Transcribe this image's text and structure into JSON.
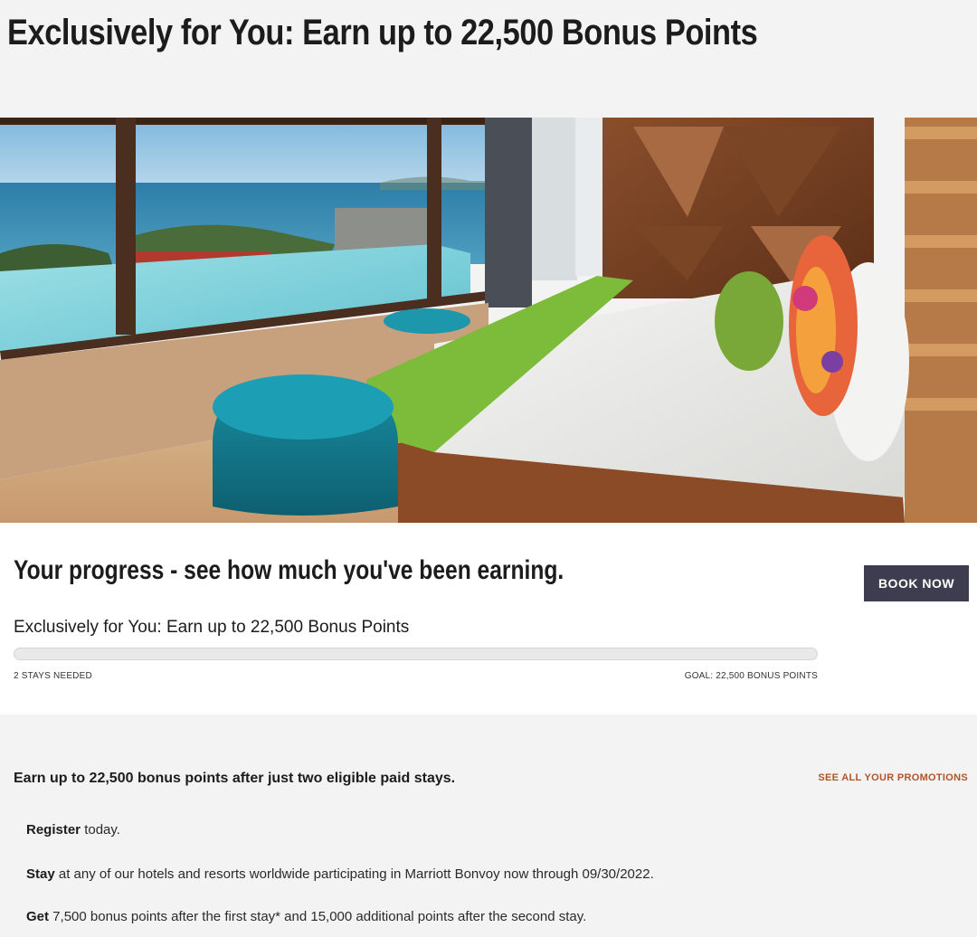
{
  "header": {
    "title": "Exclusively for You: Earn up to 22,500 Bonus Points"
  },
  "hero": {
    "image_description_icon": "hotel-room-ocean-view-image"
  },
  "progress": {
    "heading": "Your progress - see how much you've been earning.",
    "book_button_label": "BOOK NOW",
    "promo_title": "Exclusively for You: Earn up to 22,500 Bonus Points",
    "progress_fraction": 0,
    "stays_label": "2 STAYS NEEDED",
    "goal_label": "GOAL: 22,500 BONUS POINTS"
  },
  "details": {
    "heading": "Earn up to 22,500 bonus points after just two eligible paid stays.",
    "see_all_label": "SEE ALL YOUR PROMOTIONS",
    "steps": [
      {
        "bold": "Register",
        "text": " today."
      },
      {
        "bold": "Stay",
        "text": " at any of our hotels and resorts worldwide participating in Marriott Bonvoy now through 09/30/2022."
      },
      {
        "bold": "Get",
        "text": " 7,500 bonus points after the first stay* and 15,000 additional points after the second stay."
      }
    ]
  },
  "colors": {
    "button_bg": "#3e3d4f",
    "link": "#b0542b",
    "page_bg": "#f3f3f3"
  }
}
